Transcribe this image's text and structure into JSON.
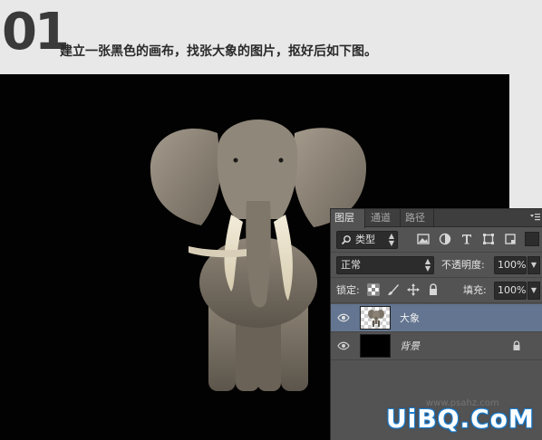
{
  "header": {
    "step_number": "01",
    "instruction": "建立一张黑色的画布，找张大象的图片，抠好后如下图。"
  },
  "layers_panel": {
    "tabs": [
      {
        "label": "图层",
        "active": true
      },
      {
        "label": "通道",
        "active": false
      },
      {
        "label": "路径",
        "active": false
      }
    ],
    "filter": {
      "value": "类型",
      "icon": "search-icon"
    },
    "filter_icons": [
      "image-filter-icon",
      "adjustment-filter-icon",
      "type-filter-icon",
      "shape-filter-icon",
      "smart-object-filter-icon"
    ],
    "blend_mode": "正常",
    "opacity_label": "不透明度:",
    "opacity_value": "100%",
    "lock_label": "锁定:",
    "lock_icons": [
      "lock-transparent-icon",
      "lock-image-icon",
      "lock-position-icon",
      "lock-all-icon"
    ],
    "fill_label": "填充:",
    "fill_value": "100%",
    "layers": [
      {
        "name": "大象",
        "visible": true,
        "selected": true,
        "locked": false
      },
      {
        "name": "背景",
        "visible": true,
        "selected": false,
        "locked": true
      }
    ]
  },
  "watermark": {
    "text": "UiBQ.CoM",
    "small_text": "www.psahz.com"
  },
  "colors": {
    "canvas": "#020202",
    "panel_bg": "#535353",
    "selected_layer": "#637590",
    "watermark_outline": "#1a7fd0"
  }
}
